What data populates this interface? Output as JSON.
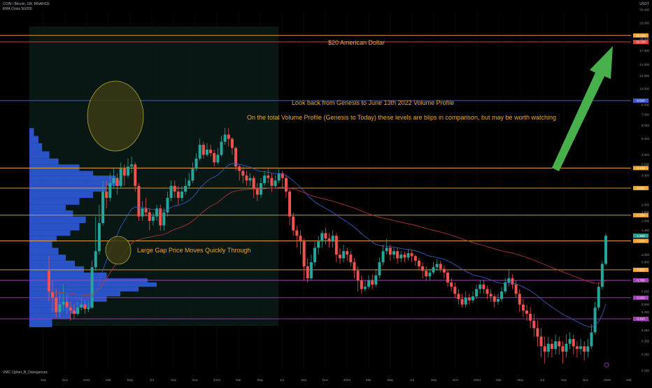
{
  "chart_title": "COIN / Bitcoin, 1W, BINANCE",
  "indicator_label": "EMA Cross 50/200",
  "oscillator_label": "VMC Cipher_B_Divergences",
  "annotations": {
    "level_label": "$20 American Dollar",
    "lookback": "Look back from Genesis to June 13th 2022 Volume Profile",
    "total_vp": "On the total Volume Profile (Genesis to Today) these levels are blips in comparison, but may be worth watching",
    "gap": "Large Gap Price Moves Quickly Through"
  },
  "colors": {
    "background": "#000000",
    "bull": "#26a69a",
    "bear": "#ef5350",
    "orange_level": "#f0a63a",
    "red_level": "#ef3b3b",
    "blue_level": "#3f5bd8",
    "purple_level": "#a23fb5",
    "volume_profile": "#2f5ee6",
    "arrow": "#48b04a",
    "ellipse": "#c8c23a",
    "ema_fast": "#3a5fcf",
    "ema_slow": "#b73a3a"
  },
  "axis": {
    "price_ticks": [
      "30.000",
      "25.000",
      "20.000",
      "17.000",
      "14.000",
      "12.000",
      "10.000",
      "8.000",
      "7.000",
      "6.000",
      "5.000",
      "4.000",
      "3.500",
      "3.000",
      "2.500",
      "2.000",
      "1.800",
      "1.600",
      "1.400",
      "1.200",
      "1.000",
      "0.900",
      "0.800",
      "0.700",
      "0.600",
      "0.500",
      "0.450",
      "0.400",
      "0.350",
      "0.300",
      "0.250",
      "0.200"
    ],
    "time_ticks": [
      "Sep",
      "Nov",
      "2021",
      "Mar",
      "May",
      "Jul",
      "Sep",
      "Nov",
      "2022",
      "Mar",
      "May",
      "Jul",
      "Sep",
      "Nov",
      "2023",
      "Mar",
      "May",
      "Jul",
      "Sep",
      "Nov",
      "2024",
      "Mar",
      "May",
      "Jul",
      "Sep",
      "Nov",
      "2025",
      "Mar"
    ],
    "currency": "USDT"
  },
  "chart_data": {
    "type": "candlestick",
    "title": "COIN / Bitcoin, 1W, BINANCE",
    "y_scale": "log",
    "ylim": [
      0.2,
      30
    ],
    "levels": [
      {
        "value": 21.0,
        "color": "orange"
      },
      {
        "value": 19.2,
        "color": "red",
        "label": "$20 American Dollar"
      },
      {
        "value": 8.5,
        "color": "blue"
      },
      {
        "value": 3.33,
        "color": "orange"
      },
      {
        "value": 2.52,
        "color": "orange"
      },
      {
        "value": 1.73,
        "color": "orange"
      },
      {
        "value": 1.21,
        "color": "orange"
      },
      {
        "value": 0.81,
        "color": "orange"
      },
      {
        "value": 0.7,
        "color": "purple"
      },
      {
        "value": 0.55,
        "color": "purple"
      },
      {
        "value": 0.41,
        "color": "purple"
      }
    ],
    "candles": [
      [
        0.8,
        0.6,
        0.98,
        0.52
      ],
      [
        0.6,
        0.55,
        0.7,
        0.45
      ],
      [
        0.55,
        0.45,
        0.62,
        0.42
      ],
      [
        0.45,
        0.5,
        0.6,
        0.42
      ],
      [
        0.5,
        0.52,
        0.66,
        0.46
      ],
      [
        0.52,
        0.48,
        0.58,
        0.44
      ],
      [
        0.48,
        0.46,
        0.52,
        0.4
      ],
      [
        0.46,
        0.44,
        0.5,
        0.41
      ],
      [
        0.44,
        0.48,
        0.52,
        0.43
      ],
      [
        0.48,
        0.5,
        0.55,
        0.46
      ],
      [
        0.5,
        0.47,
        0.53,
        0.44
      ],
      [
        0.47,
        0.48,
        0.52,
        0.45
      ],
      [
        0.48,
        0.84,
        0.92,
        0.47
      ],
      [
        0.84,
        1.05,
        1.7,
        0.8
      ],
      [
        1.05,
        1.55,
        2.0,
        1.0
      ],
      [
        1.55,
        2.4,
        2.8,
        1.5
      ],
      [
        2.4,
        2.2,
        2.8,
        1.9
      ],
      [
        2.2,
        2.7,
        3.1,
        2.1
      ],
      [
        2.7,
        2.9,
        3.3,
        2.5
      ],
      [
        2.9,
        2.6,
        3.1,
        2.3
      ],
      [
        2.6,
        3.3,
        3.6,
        2.5
      ],
      [
        3.3,
        3.0,
        3.5,
        2.6
      ],
      [
        3.0,
        3.4,
        3.8,
        2.9
      ],
      [
        3.4,
        3.5,
        3.9,
        3.1
      ],
      [
        3.5,
        2.6,
        3.6,
        2.4
      ],
      [
        2.6,
        1.7,
        2.7,
        1.6
      ],
      [
        1.7,
        1.9,
        2.1,
        1.6
      ],
      [
        1.9,
        1.8,
        2.2,
        1.7
      ],
      [
        1.8,
        1.6,
        1.9,
        1.4
      ],
      [
        1.6,
        1.7,
        1.8,
        1.5
      ],
      [
        1.7,
        1.9,
        2.0,
        1.6
      ],
      [
        1.9,
        1.5,
        2.0,
        1.4
      ],
      [
        1.5,
        1.8,
        1.9,
        1.4
      ],
      [
        1.8,
        2.2,
        2.4,
        1.7
      ],
      [
        2.2,
        2.6,
        2.8,
        2.1
      ],
      [
        2.6,
        2.4,
        2.8,
        2.2
      ],
      [
        2.4,
        2.2,
        2.6,
        2.0
      ],
      [
        2.2,
        2.4,
        2.6,
        2.1
      ],
      [
        2.4,
        2.6,
        2.9,
        2.3
      ],
      [
        2.6,
        2.8,
        3.1,
        2.5
      ],
      [
        2.8,
        3.3,
        3.6,
        2.7
      ],
      [
        3.3,
        3.8,
        4.1,
        3.2
      ],
      [
        3.8,
        4.6,
        5.0,
        3.7
      ],
      [
        4.6,
        4.0,
        4.8,
        3.8
      ],
      [
        4.0,
        4.3,
        4.7,
        3.9
      ],
      [
        4.3,
        4.1,
        4.6,
        3.9
      ],
      [
        4.1,
        3.6,
        4.3,
        3.4
      ],
      [
        3.6,
        4.0,
        4.4,
        3.5
      ],
      [
        4.0,
        4.8,
        5.2,
        3.9
      ],
      [
        4.8,
        5.3,
        5.8,
        4.6
      ],
      [
        5.3,
        5.0,
        5.8,
        4.5
      ],
      [
        5.0,
        4.4,
        5.1,
        4.0
      ],
      [
        4.4,
        3.4,
        4.5,
        3.2
      ],
      [
        3.4,
        3.2,
        3.5,
        2.8
      ],
      [
        3.2,
        3.0,
        3.4,
        2.7
      ],
      [
        3.0,
        2.8,
        3.2,
        2.6
      ],
      [
        2.8,
        2.9,
        3.1,
        2.6
      ],
      [
        2.9,
        2.5,
        3.0,
        2.2
      ],
      [
        2.5,
        2.3,
        2.7,
        2.1
      ],
      [
        2.3,
        2.7,
        2.9,
        2.2
      ],
      [
        2.7,
        3.0,
        3.2,
        2.6
      ],
      [
        3.0,
        2.9,
        3.3,
        2.7
      ],
      [
        2.9,
        2.6,
        3.1,
        2.4
      ],
      [
        2.6,
        2.8,
        3.0,
        2.5
      ],
      [
        2.8,
        3.1,
        3.3,
        2.7
      ],
      [
        3.1,
        2.9,
        3.2,
        2.5
      ],
      [
        2.9,
        2.4,
        3.0,
        2.2
      ],
      [
        2.4,
        1.7,
        2.5,
        1.5
      ],
      [
        1.7,
        1.4,
        1.8,
        1.3
      ],
      [
        1.4,
        1.3,
        1.5,
        1.1
      ],
      [
        1.3,
        1.2,
        1.4,
        1.0
      ],
      [
        1.2,
        0.85,
        1.25,
        0.7
      ],
      [
        0.85,
        0.72,
        0.95,
        0.68
      ],
      [
        0.72,
        0.9,
        1.0,
        0.7
      ],
      [
        0.9,
        1.1,
        1.2,
        0.85
      ],
      [
        1.1,
        1.2,
        1.3,
        1.0
      ],
      [
        1.2,
        1.35,
        1.4,
        1.1
      ],
      [
        1.35,
        1.25,
        1.45,
        1.15
      ],
      [
        1.25,
        1.2,
        1.35,
        1.1
      ],
      [
        1.2,
        1.3,
        1.4,
        1.1
      ],
      [
        1.3,
        1.0,
        1.35,
        0.9
      ],
      [
        1.0,
        0.95,
        1.1,
        0.88
      ],
      [
        0.95,
        1.05,
        1.15,
        0.9
      ],
      [
        1.05,
        1.0,
        1.1,
        0.92
      ],
      [
        1.0,
        0.9,
        1.05,
        0.85
      ],
      [
        0.9,
        0.8,
        0.95,
        0.72
      ],
      [
        0.8,
        0.7,
        0.85,
        0.6
      ],
      [
        0.7,
        0.62,
        0.75,
        0.58
      ],
      [
        0.62,
        0.64,
        0.7,
        0.6
      ],
      [
        0.64,
        0.7,
        0.75,
        0.62
      ],
      [
        0.7,
        0.66,
        0.76,
        0.62
      ],
      [
        0.66,
        0.75,
        0.82,
        0.64
      ],
      [
        0.75,
        0.9,
        0.96,
        0.72
      ],
      [
        0.9,
        1.05,
        1.15,
        0.86
      ],
      [
        1.05,
        1.1,
        1.25,
        1.0
      ],
      [
        1.1,
        1.0,
        1.15,
        0.92
      ],
      [
        1.0,
        1.05,
        1.1,
        0.94
      ],
      [
        1.05,
        0.95,
        1.1,
        0.88
      ],
      [
        0.95,
        1.0,
        1.05,
        0.9
      ],
      [
        1.0,
        0.96,
        1.04,
        0.9
      ],
      [
        0.96,
        1.02,
        1.08,
        0.92
      ],
      [
        1.02,
        0.98,
        1.06,
        0.9
      ],
      [
        0.98,
        0.92,
        1.0,
        0.86
      ],
      [
        0.92,
        0.85,
        0.96,
        0.8
      ],
      [
        0.85,
        0.8,
        0.9,
        0.72
      ],
      [
        0.8,
        0.74,
        0.85,
        0.7
      ],
      [
        0.74,
        0.78,
        0.82,
        0.7
      ],
      [
        0.78,
        0.84,
        0.9,
        0.76
      ],
      [
        0.84,
        0.88,
        0.94,
        0.8
      ],
      [
        0.88,
        0.82,
        0.92,
        0.78
      ],
      [
        0.82,
        0.78,
        0.86,
        0.72
      ],
      [
        0.78,
        0.68,
        0.8,
        0.64
      ],
      [
        0.68,
        0.64,
        0.72,
        0.6
      ],
      [
        0.64,
        0.58,
        0.68,
        0.55
      ],
      [
        0.58,
        0.54,
        0.62,
        0.5
      ],
      [
        0.54,
        0.5,
        0.58,
        0.48
      ],
      [
        0.5,
        0.55,
        0.6,
        0.48
      ],
      [
        0.55,
        0.53,
        0.58,
        0.5
      ],
      [
        0.53,
        0.56,
        0.6,
        0.51
      ],
      [
        0.56,
        0.62,
        0.66,
        0.54
      ],
      [
        0.62,
        0.66,
        0.7,
        0.58
      ],
      [
        0.66,
        0.62,
        0.7,
        0.58
      ],
      [
        0.62,
        0.58,
        0.65,
        0.54
      ],
      [
        0.58,
        0.56,
        0.62,
        0.52
      ],
      [
        0.56,
        0.52,
        0.58,
        0.48
      ],
      [
        0.52,
        0.54,
        0.58,
        0.5
      ],
      [
        0.54,
        0.6,
        0.64,
        0.52
      ],
      [
        0.6,
        0.68,
        0.72,
        0.58
      ],
      [
        0.68,
        0.72,
        0.82,
        0.64
      ],
      [
        0.72,
        0.66,
        0.76,
        0.62
      ],
      [
        0.66,
        0.58,
        0.7,
        0.55
      ],
      [
        0.58,
        0.5,
        0.62,
        0.45
      ],
      [
        0.5,
        0.46,
        0.54,
        0.42
      ],
      [
        0.46,
        0.44,
        0.5,
        0.4
      ],
      [
        0.44,
        0.4,
        0.48,
        0.36
      ],
      [
        0.4,
        0.36,
        0.44,
        0.32
      ],
      [
        0.36,
        0.32,
        0.4,
        0.28
      ],
      [
        0.32,
        0.28,
        0.36,
        0.24
      ],
      [
        0.28,
        0.26,
        0.32,
        0.22
      ],
      [
        0.26,
        0.29,
        0.32,
        0.24
      ],
      [
        0.29,
        0.27,
        0.31,
        0.24
      ],
      [
        0.27,
        0.3,
        0.33,
        0.25
      ],
      [
        0.3,
        0.28,
        0.32,
        0.25
      ],
      [
        0.28,
        0.26,
        0.3,
        0.22
      ],
      [
        0.26,
        0.29,
        0.33,
        0.24
      ],
      [
        0.29,
        0.31,
        0.34,
        0.27
      ],
      [
        0.31,
        0.28,
        0.33,
        0.25
      ],
      [
        0.28,
        0.27,
        0.3,
        0.24
      ],
      [
        0.27,
        0.28,
        0.31,
        0.25
      ],
      [
        0.28,
        0.26,
        0.3,
        0.23
      ],
      [
        0.26,
        0.28,
        0.31,
        0.24
      ],
      [
        0.28,
        0.34,
        0.38,
        0.27
      ],
      [
        0.34,
        0.48,
        0.52,
        0.33
      ],
      [
        0.48,
        0.64,
        0.68,
        0.46
      ],
      [
        0.64,
        0.88,
        0.92,
        0.62
      ],
      [
        0.88,
        1.3,
        1.35,
        0.86
      ]
    ],
    "ema_fast": [
      null
    ],
    "volume_profile_rows": [
      [
        5.8,
        0.05
      ],
      [
        5.2,
        0.1
      ],
      [
        4.7,
        0.14
      ],
      [
        4.2,
        0.22
      ],
      [
        3.8,
        0.32
      ],
      [
        3.5,
        0.55
      ],
      [
        3.2,
        0.7
      ],
      [
        3.0,
        0.95
      ],
      [
        2.8,
        1.0
      ],
      [
        2.6,
        0.85
      ],
      [
        2.4,
        0.7
      ],
      [
        2.2,
        0.55
      ],
      [
        2.0,
        0.4
      ],
      [
        1.85,
        0.48
      ],
      [
        1.7,
        0.62
      ],
      [
        1.55,
        0.55
      ],
      [
        1.4,
        0.45
      ],
      [
        1.3,
        0.3
      ],
      [
        1.2,
        0.25
      ],
      [
        1.1,
        0.32
      ],
      [
        1.0,
        0.4
      ],
      [
        0.92,
        0.5
      ],
      [
        0.85,
        0.6
      ],
      [
        0.78,
        0.85
      ],
      [
        0.72,
        1.3
      ],
      [
        0.68,
        1.4
      ],
      [
        0.64,
        1.2
      ],
      [
        0.6,
        1.0
      ],
      [
        0.56,
        0.85
      ],
      [
        0.52,
        0.7
      ],
      [
        0.48,
        0.55
      ],
      [
        0.44,
        0.45
      ],
      [
        0.41,
        0.25
      ]
    ]
  },
  "price_tags": [
    {
      "label": "21.000",
      "color": "orange"
    },
    {
      "label": "19.200",
      "color": "red"
    },
    {
      "label": "8.500",
      "color": "blue"
    },
    {
      "label": "3.330",
      "color": "orange"
    },
    {
      "label": "2.520",
      "color": "orange"
    },
    {
      "label": "1.730",
      "color": "orange"
    },
    {
      "label": "1.300",
      "color": "bull"
    },
    {
      "label": "1.210",
      "color": "orange"
    },
    {
      "label": "0.810",
      "color": "orange"
    },
    {
      "label": "0.700",
      "color": "purple"
    },
    {
      "label": "0.550",
      "color": "purple"
    },
    {
      "label": "0.410",
      "color": "purple"
    }
  ]
}
